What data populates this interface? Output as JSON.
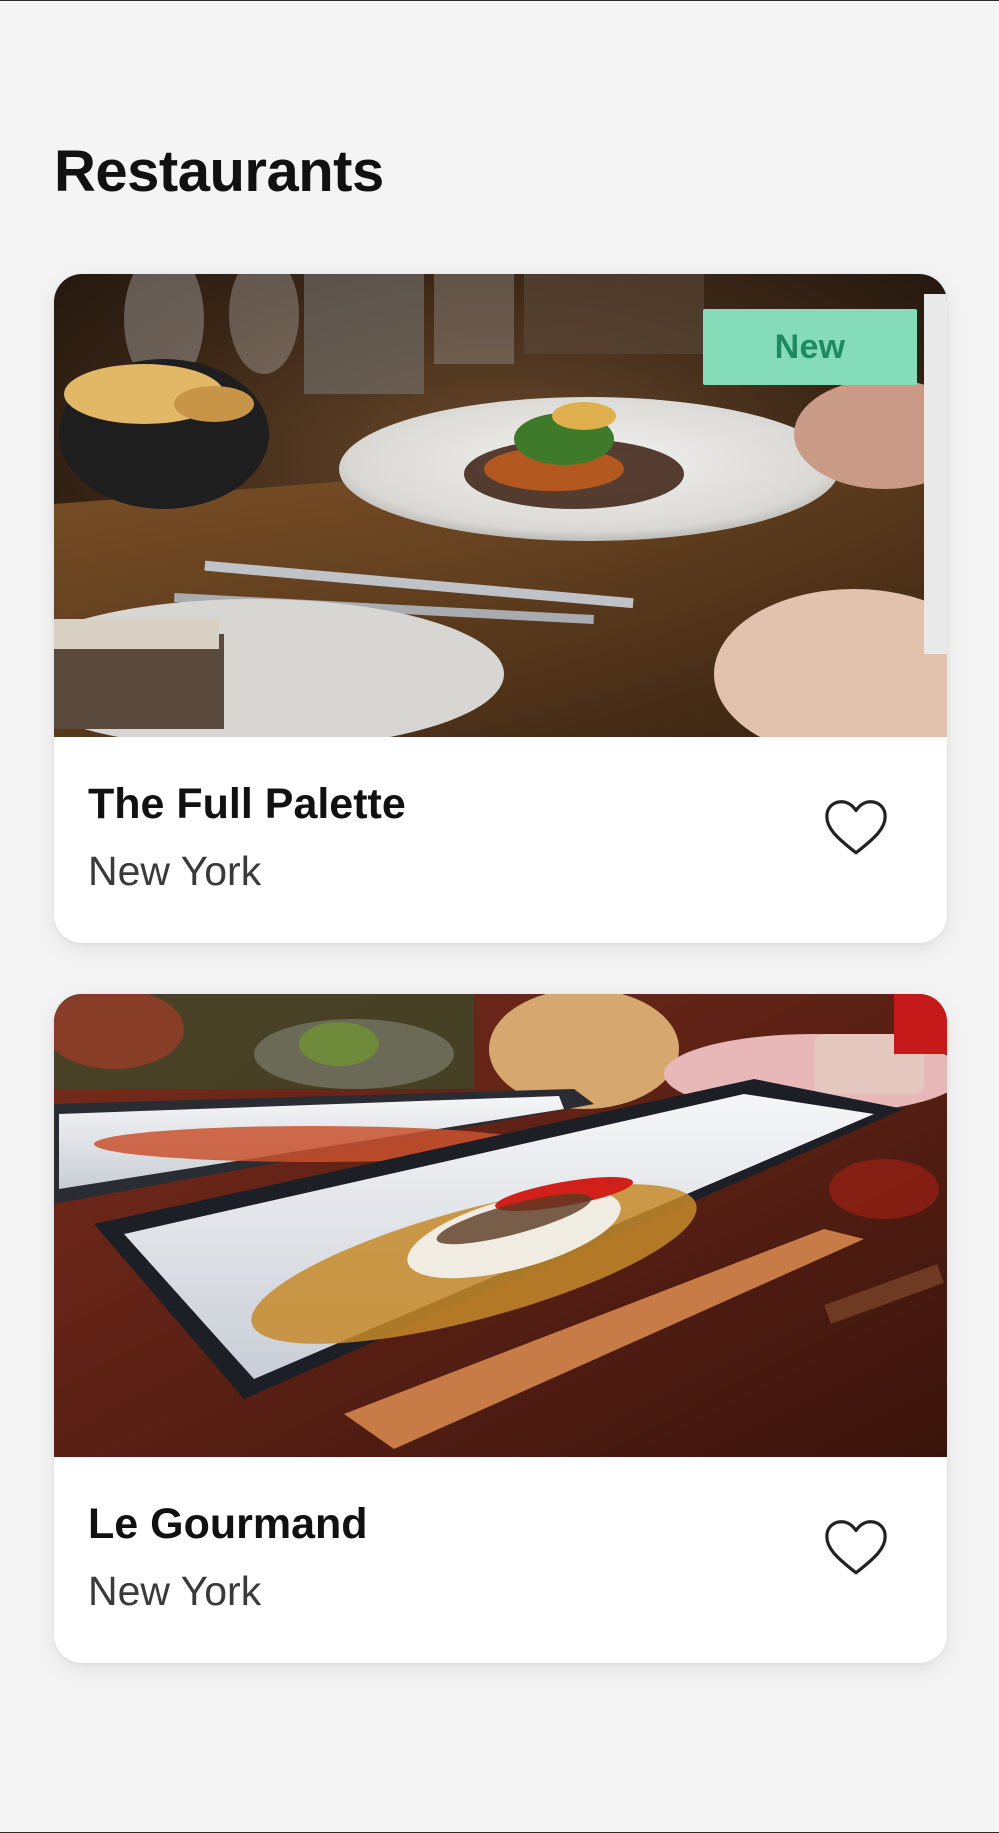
{
  "page": {
    "title": "Restaurants"
  },
  "restaurants": [
    {
      "name": "The Full Palette",
      "location": "New York",
      "badge": "New",
      "image_alt": "plated dish on a restaurant table"
    },
    {
      "name": "Le Gourmand",
      "location": "New York",
      "badge": "",
      "image_alt": "fish dish on long ceramic plates"
    }
  ],
  "icons": {
    "favorite": "heart-outline-icon"
  },
  "colors": {
    "badge_bg": "#84dcbb",
    "badge_text": "#1f8a62",
    "background": "#f4f4f4",
    "card": "#ffffff"
  }
}
